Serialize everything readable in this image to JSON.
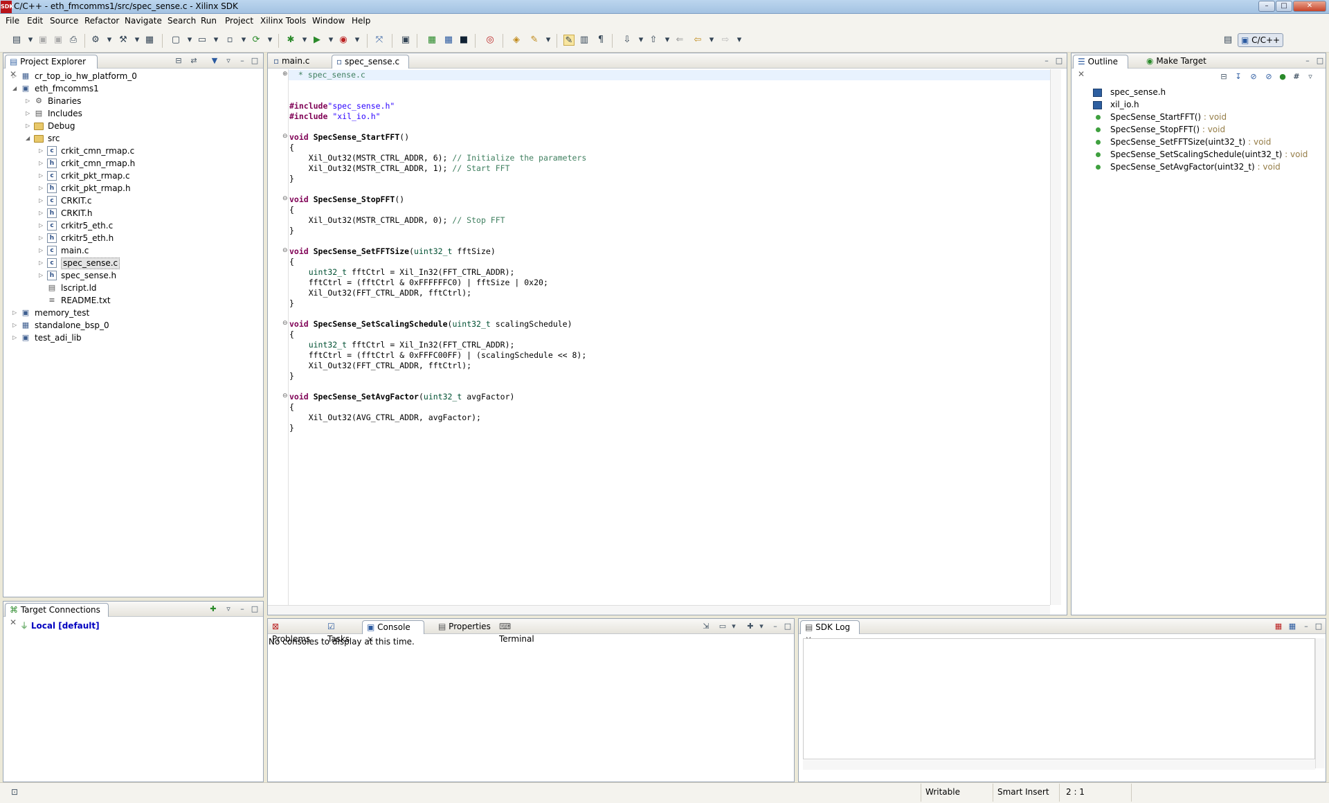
{
  "window": {
    "app_icon": "SDK",
    "title": "C/C++ - eth_fmcomms1/src/spec_sense.c - Xilinx SDK",
    "controls": [
      "–",
      "□",
      "✕"
    ]
  },
  "menu": [
    "File",
    "Edit",
    "Source",
    "Refactor",
    "Navigate",
    "Search",
    "Run",
    "Project",
    "Xilinx Tools",
    "Window",
    "Help"
  ],
  "perspective": {
    "label": "C/C++"
  },
  "project_explorer": {
    "title": "Project Explorer",
    "items": [
      {
        "label": "cr_top_io_hw_platform_0",
        "arrow": "▷",
        "icon": "hw-platform"
      },
      {
        "label": "eth_fmcomms1",
        "arrow": "◢",
        "icon": "project"
      },
      {
        "label": "Binaries",
        "arrow": "▷",
        "icon": "binaries"
      },
      {
        "label": "Includes",
        "arrow": "▷",
        "icon": "includes"
      },
      {
        "label": "Debug",
        "arrow": "▷",
        "icon": "folder"
      },
      {
        "label": "src",
        "arrow": "◢",
        "icon": "folder"
      },
      {
        "label": "crkit_cmn_rmap.c",
        "arrow": "▷",
        "icon": "c-file"
      },
      {
        "label": "crkit_cmn_rmap.h",
        "arrow": "▷",
        "icon": "h-file"
      },
      {
        "label": "crkit_pkt_rmap.c",
        "arrow": "▷",
        "icon": "c-file"
      },
      {
        "label": "crkit_pkt_rmap.h",
        "arrow": "▷",
        "icon": "h-file"
      },
      {
        "label": "CRKIT.c",
        "arrow": "▷",
        "icon": "c-file"
      },
      {
        "label": "CRKIT.h",
        "arrow": "▷",
        "icon": "h-file"
      },
      {
        "label": "crkitr5_eth.c",
        "arrow": "▷",
        "icon": "c-file"
      },
      {
        "label": "crkitr5_eth.h",
        "arrow": "▷",
        "icon": "h-file"
      },
      {
        "label": "main.c",
        "arrow": "▷",
        "icon": "c-file"
      },
      {
        "label": "spec_sense.c",
        "arrow": "▷",
        "icon": "c-file"
      },
      {
        "label": "spec_sense.h",
        "arrow": "▷",
        "icon": "h-file"
      },
      {
        "label": "lscript.ld",
        "arrow": "",
        "icon": "ld-file"
      },
      {
        "label": "README.txt",
        "arrow": "",
        "icon": "txt-file"
      },
      {
        "label": "memory_test",
        "arrow": "▷",
        "icon": "project"
      },
      {
        "label": "standalone_bsp_0",
        "arrow": "▷",
        "icon": "bsp"
      },
      {
        "label": "test_adi_lib",
        "arrow": "▷",
        "icon": "project"
      }
    ]
  },
  "target_connections": {
    "title": "Target Connections",
    "item": "Local [default]"
  },
  "editor": {
    "tabs": [
      {
        "label": "main.c"
      },
      {
        "label": "spec_sense.c"
      }
    ],
    "header_comment": " * spec_sense.c",
    "lines": [
      {
        "type": "include",
        "kw": "#include",
        "str": "\"spec_sense.h\""
      },
      {
        "type": "include",
        "kw": "#include",
        "str": " \"xil_io.h\""
      },
      {
        "type": "fn",
        "kw": "void",
        "name": " SpecSense_StartFFT",
        "rest": "()"
      },
      {
        "type": "plain",
        "text": "{"
      },
      {
        "type": "stmt",
        "text": "    Xil_Out32(MSTR_CTRL_ADDR, 6); ",
        "cm": "// Initialize the parameters"
      },
      {
        "type": "stmt",
        "text": "    Xil_Out32(MSTR_CTRL_ADDR, 1); ",
        "cm": "// Start FFT"
      },
      {
        "type": "plain",
        "text": "}"
      },
      {
        "type": "fn",
        "kw": "void",
        "name": " SpecSense_StopFFT",
        "rest": "()"
      },
      {
        "type": "plain",
        "text": "{"
      },
      {
        "type": "stmt",
        "text": "    Xil_Out32(MSTR_CTRL_ADDR, 0); ",
        "cm": "// Stop FFT"
      },
      {
        "type": "plain",
        "text": "}"
      },
      {
        "type": "fnp",
        "kw": "void",
        "name": " SpecSense_SetFFTSize",
        "open": "(",
        "ptype": "uint32_t",
        "rest": " fftSize)"
      },
      {
        "type": "plain",
        "text": "{"
      },
      {
        "type": "decl",
        "ptype": "    uint32_t",
        "text": " fftCtrl = Xil_In32(FFT_CTRL_ADDR);"
      },
      {
        "type": "plain",
        "text": "    fftCtrl = (fftCtrl & 0xFFFFFFC0) | fftSize | 0x20;"
      },
      {
        "type": "plain",
        "text": "    Xil_Out32(FFT_CTRL_ADDR, fftCtrl);"
      },
      {
        "type": "plain",
        "text": "}"
      },
      {
        "type": "fnp",
        "kw": "void",
        "name": " SpecSense_SetScalingSchedule",
        "open": "(",
        "ptype": "uint32_t",
        "rest": " scalingSchedule)"
      },
      {
        "type": "plain",
        "text": "{"
      },
      {
        "type": "decl",
        "ptype": "    uint32_t",
        "text": " fftCtrl = Xil_In32(FFT_CTRL_ADDR);"
      },
      {
        "type": "plain",
        "text": "    fftCtrl = (fftCtrl & 0xFFFC00FF) | (scalingSchedule << 8);"
      },
      {
        "type": "plain",
        "text": "    Xil_Out32(FFT_CTRL_ADDR, fftCtrl);"
      },
      {
        "type": "plain",
        "text": "}"
      },
      {
        "type": "fnp",
        "kw": "void",
        "name": " SpecSense_SetAvgFactor",
        "open": "(",
        "ptype": "uint32_t",
        "rest": " avgFactor)"
      },
      {
        "type": "plain",
        "text": "{"
      },
      {
        "type": "plain",
        "text": "    Xil_Out32(AVG_CTRL_ADDR, avgFactor);"
      },
      {
        "type": "plain",
        "text": "}"
      }
    ]
  },
  "outline": {
    "tabs": [
      {
        "label": "Outline"
      },
      {
        "label": "Make Target"
      }
    ],
    "items": [
      {
        "name": "spec_sense.h",
        "ret": "",
        "kind": "include"
      },
      {
        "name": "xil_io.h",
        "ret": "",
        "kind": "include"
      },
      {
        "name": "SpecSense_StartFFT()",
        "ret": " : void",
        "kind": "function"
      },
      {
        "name": "SpecSense_StopFFT()",
        "ret": " : void",
        "kind": "function"
      },
      {
        "name": "SpecSense_SetFFTSize(uint32_t)",
        "ret": " : void",
        "kind": "function"
      },
      {
        "name": "SpecSense_SetScalingSchedule(uint32_t)",
        "ret": " : void",
        "kind": "function"
      },
      {
        "name": "SpecSense_SetAvgFactor(uint32_t)",
        "ret": " : void",
        "kind": "function"
      }
    ]
  },
  "bottom": {
    "tabs": [
      {
        "label": "Problems"
      },
      {
        "label": "Tasks"
      },
      {
        "label": "Console"
      },
      {
        "label": "Properties"
      },
      {
        "label": "Terminal"
      }
    ],
    "console_message": "No consoles to display at this time.",
    "sdk_log_title": "SDK Log"
  },
  "status": {
    "writable": "Writable",
    "insert": "Smart Insert",
    "position": "2 : 1"
  },
  "colors": {
    "keyword": "#7f0055",
    "string": "#2a00ff",
    "comment": "#3f7f5f",
    "type": "#005032",
    "link": "#0000c0"
  }
}
